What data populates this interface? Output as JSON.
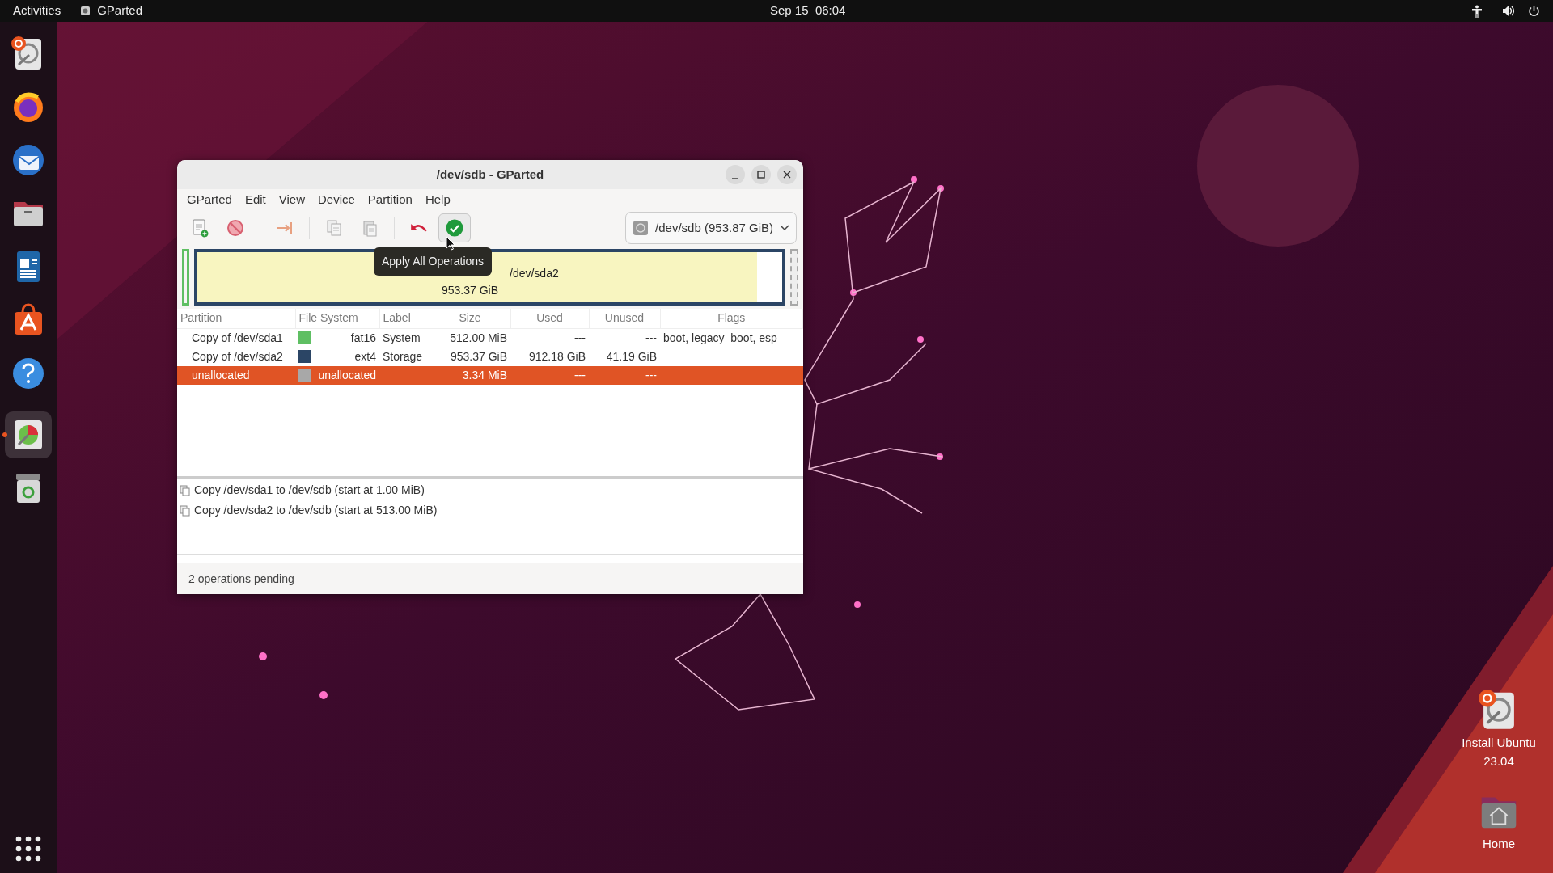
{
  "top_bar": {
    "activities": "Activities",
    "app": "GParted",
    "clock": "Sep 15  06:04"
  },
  "dock": [
    {
      "kind": "installer",
      "running": false
    },
    {
      "kind": "browser",
      "running": false
    },
    {
      "kind": "mail",
      "running": false
    },
    {
      "kind": "files",
      "running": false
    },
    {
      "kind": "writer",
      "running": false
    },
    {
      "kind": "store",
      "running": false
    },
    {
      "kind": "help",
      "running": false
    },
    {
      "kind": "gparted",
      "running": true
    },
    {
      "kind": "trash",
      "running": false
    }
  ],
  "window": {
    "title": "/dev/sdb - GParted"
  },
  "menu": [
    "GParted",
    "Edit",
    "View",
    "Device",
    "Partition",
    "Help"
  ],
  "toolbar": [
    {
      "kind": "new",
      "hovered": false
    },
    {
      "kind": "delete",
      "hovered": false
    },
    {
      "kind": "separator"
    },
    {
      "kind": "resize",
      "hovered": false
    },
    {
      "kind": "separator"
    },
    {
      "kind": "copy",
      "hovered": false
    },
    {
      "kind": "paste",
      "hovered": false
    },
    {
      "kind": "separator"
    },
    {
      "kind": "undo",
      "hovered": false
    },
    {
      "kind": "apply",
      "hovered": true
    }
  ],
  "device_selector": "/dev/sdb (953.87 GiB)",
  "graph": {
    "segments": [
      {
        "kind": "small",
        "color": "#5fbf63"
      },
      {
        "kind": "main",
        "color": "#2b4565",
        "level": 0.957,
        "label": "/dev/sda2",
        "size": "953.37 GiB"
      },
      {
        "kind": "unallocated",
        "color": "#a8a8a8"
      }
    ]
  },
  "tooltip": "Apply All Operations",
  "table": {
    "columns": [
      "Partition",
      "File System",
      "Label",
      "Size",
      "Used",
      "Unused",
      "Flags"
    ],
    "rows": [
      {
        "partition": "Copy of /dev/sda1",
        "color": "#5fbf63",
        "file_system": "fat16",
        "label": "System",
        "size": "512.00 MiB",
        "used": "---",
        "unused": "---",
        "flags": "boot, legacy_boot, esp",
        "selected": false
      },
      {
        "partition": "Copy of /dev/sda2",
        "color": "#2b4565",
        "file_system": "ext4",
        "label": "Storage",
        "size": "953.37 GiB",
        "used": "912.18 GiB",
        "unused": "41.19 GiB",
        "selected": false
      },
      {
        "partition": "unallocated",
        "color": "#a8a8a8",
        "file_system": "unallocated",
        "size": "3.34 MiB",
        "used": "---",
        "unused": "---",
        "selected": true
      }
    ]
  },
  "operations": [
    "Copy /dev/sda1 to /dev/sdb (start at 1.00 MiB)",
    "Copy /dev/sda2 to /dev/sdb (start at 513.00 MiB)"
  ],
  "status_bar": "2 operations pending",
  "desktop_icons": [
    {
      "kind": "installer",
      "label": "Install Ubuntu 23.04"
    },
    {
      "kind": "home",
      "label": "Home"
    }
  ]
}
